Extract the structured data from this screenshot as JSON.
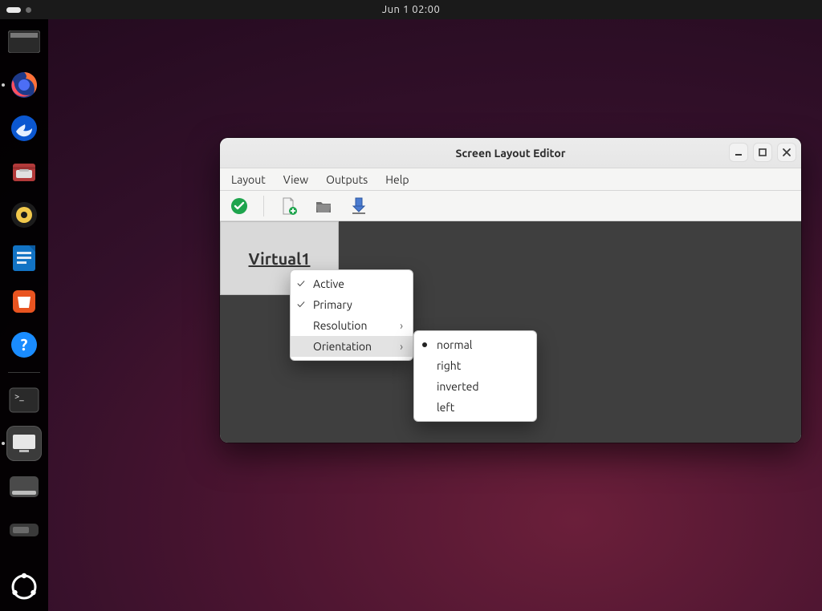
{
  "topbar": {
    "clock": "Jun 1  02:00"
  },
  "dock": {
    "items": [
      {
        "name": "firefox"
      },
      {
        "name": "thunderbird"
      },
      {
        "name": "files"
      },
      {
        "name": "rhythmbox"
      },
      {
        "name": "libreoffice-writer"
      },
      {
        "name": "ubuntu-software"
      },
      {
        "name": "help"
      }
    ]
  },
  "window": {
    "title": "Screen Layout Editor",
    "menu": {
      "layout": "Layout",
      "view": "View",
      "outputs": "Outputs",
      "help": "Help"
    },
    "output_label": "Virtual1"
  },
  "context_menu": {
    "items": {
      "active": "Active",
      "primary": "Primary",
      "resolution": "Resolution",
      "orientation": "Orientation"
    }
  },
  "orientation_submenu": {
    "items": {
      "normal": "normal",
      "right": "right",
      "inverted": "inverted",
      "left": "left"
    },
    "selected": "normal"
  }
}
